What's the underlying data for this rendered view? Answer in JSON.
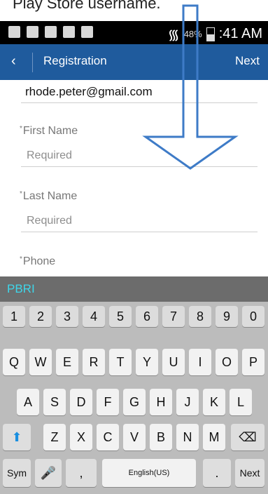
{
  "caption": "Play Store username.",
  "status": {
    "clock": ":41 AM",
    "battery": "48%"
  },
  "appbar": {
    "back": "‹",
    "title": "Registration",
    "next": "Next"
  },
  "form": {
    "email": "rhode.peter@gmail.com",
    "first_name_label": "First Name",
    "first_name_placeholder": "Required",
    "last_name_label": "Last Name",
    "last_name_placeholder": "Required",
    "phone_label": "Phone",
    "required_mark": "*"
  },
  "keyboard": {
    "suggestion": "PBRI",
    "numbers": [
      "1",
      "2",
      "3",
      "4",
      "5",
      "6",
      "7",
      "8",
      "9",
      "0"
    ],
    "row1": [
      "Q",
      "W",
      "E",
      "R",
      "T",
      "Y",
      "U",
      "I",
      "O",
      "P"
    ],
    "row2": [
      "A",
      "S",
      "D",
      "F",
      "G",
      "H",
      "J",
      "K",
      "L"
    ],
    "row3": [
      "Z",
      "X",
      "C",
      "V",
      "B",
      "N",
      "M"
    ],
    "sym": "Sym",
    "space": "English(US)",
    "next": "Next",
    "comma": ",",
    "period": "."
  }
}
